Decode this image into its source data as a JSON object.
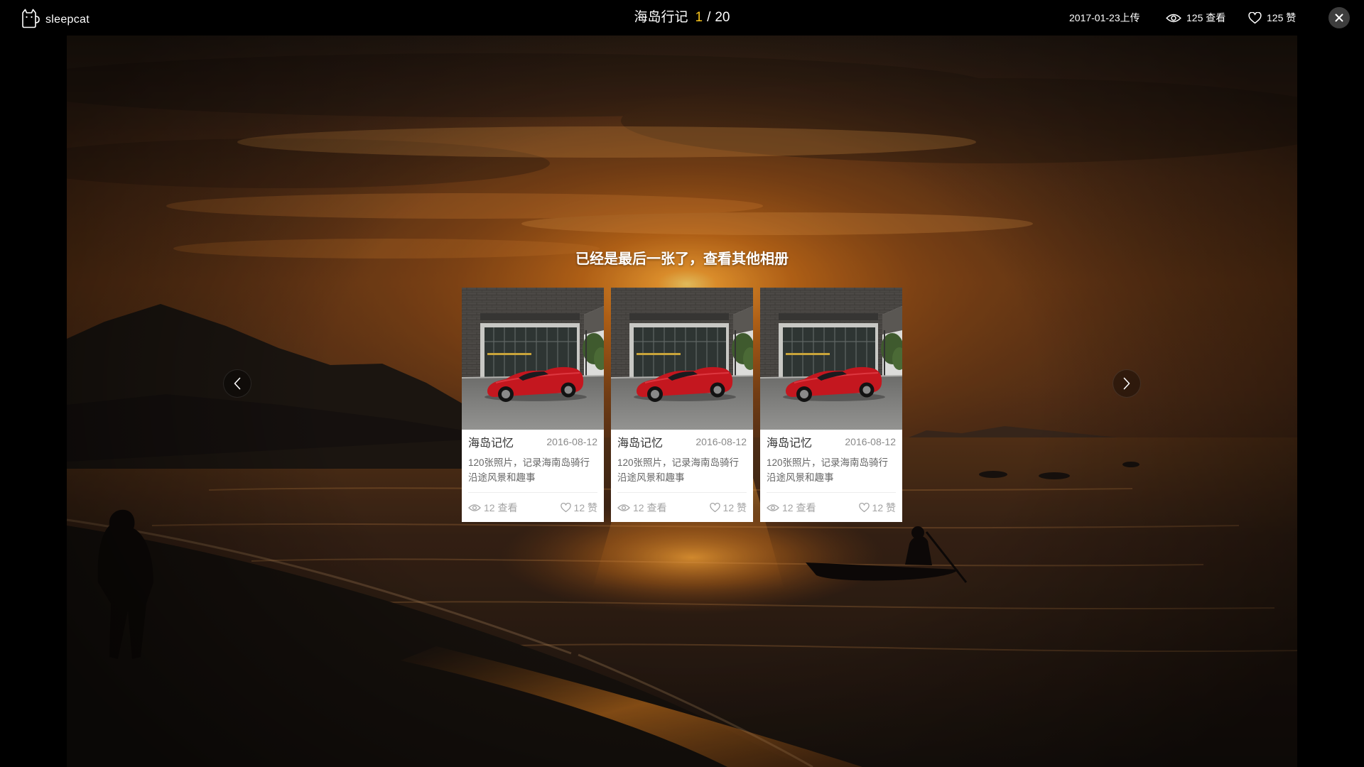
{
  "app": {
    "logo_text": "sleepcat"
  },
  "header": {
    "album_title": "海岛行记",
    "current_index": "1",
    "separator": "/",
    "total": "20",
    "upload_date": "2017-01-23上传",
    "views": "125 查看",
    "likes": "125 赞"
  },
  "viewer": {
    "end_message": "已经是最后一张了，查看其他相册"
  },
  "albums": [
    {
      "title": "海岛记忆",
      "date": "2016-08-12",
      "description": "120张照片，记录海南岛骑行沿途风景和趣事",
      "views": "12 查看",
      "likes": "12 赞"
    },
    {
      "title": "海岛记忆",
      "date": "2016-08-12",
      "description": "120张照片，记录海南岛骑行沿途风景和趣事",
      "views": "12 查看",
      "likes": "12 赞"
    },
    {
      "title": "海岛记忆",
      "date": "2016-08-12",
      "description": "120张照片，记录海南岛骑行沿途风景和趣事",
      "views": "12 查看",
      "likes": "12 赞"
    }
  ],
  "icons": {
    "logo": "cat-icon",
    "views": "eye-icon",
    "likes": "heart-icon",
    "close": "close-icon",
    "previous": "chevron-left-icon",
    "next": "chevron-right-icon"
  },
  "colors": {
    "accent": "#f5c21b",
    "topbar_background": "#000000",
    "card_background": "#ffffff",
    "card_meta_text": "#a3a3a3"
  }
}
